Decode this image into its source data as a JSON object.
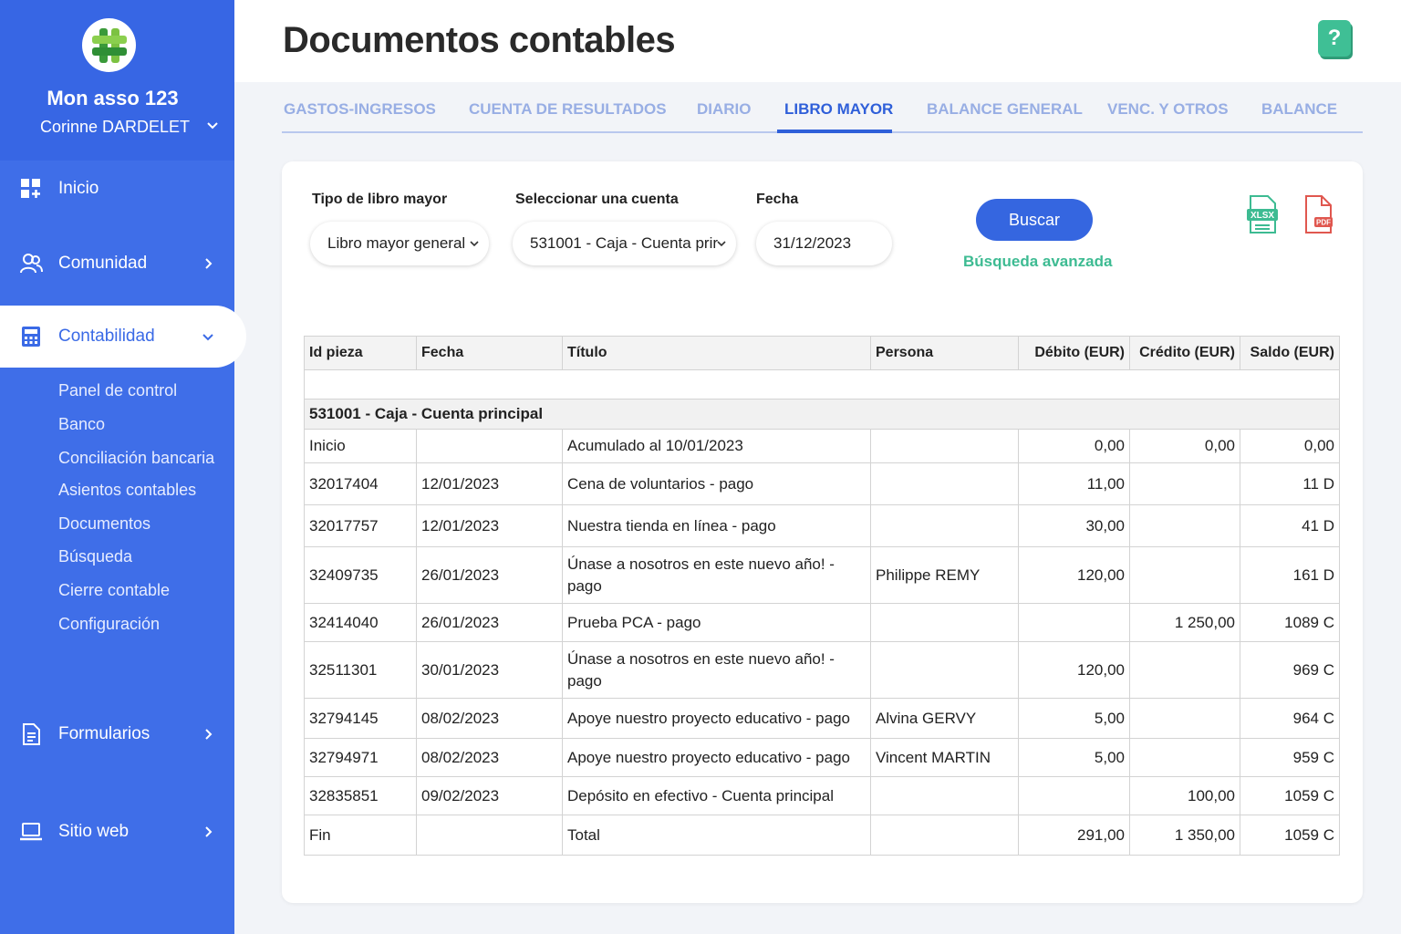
{
  "sidebar": {
    "org_name": "Mon asso 123",
    "user_name": "Corinne DARDELET",
    "nav": {
      "inicio": "Inicio",
      "comunidad": "Comunidad",
      "contabilidad": "Contabilidad",
      "formularios": "Formularios",
      "sitio_web": "Sitio web"
    },
    "sub_items": [
      "Panel de control",
      "Banco",
      "Conciliación bancaria",
      "Asientos contables",
      "Documentos",
      "Búsqueda",
      "Cierre contable",
      "Configuración"
    ]
  },
  "header": {
    "title": "Documentos contables",
    "help_label": "?"
  },
  "tabs": [
    "GASTOS-INGRESOS",
    "CUENTA DE RESULTADOS",
    "DIARIO",
    "LIBRO MAYOR",
    "BALANCE GENERAL",
    "VENC. Y OTROS",
    "BALANCE"
  ],
  "active_tab": "LIBRO MAYOR",
  "filters": {
    "tipo_label": "Tipo de libro mayor",
    "tipo_value": "Libro mayor general",
    "cuenta_label": "Seleccionar una cuenta",
    "cuenta_value": "531001 - Caja - Cuenta prir",
    "fecha_label": "Fecha",
    "fecha_value": "31/12/2023",
    "search_button": "Buscar",
    "advanced_link": "Búsqueda avanzada",
    "xlsx_label": "XLSX",
    "pdf_label": "PDF"
  },
  "table": {
    "headers": [
      "Id pieza",
      "Fecha",
      "Título",
      "Persona",
      "Débito (EUR)",
      "Crédito (EUR)",
      "Saldo (EUR)"
    ],
    "account_row": "531001 - Caja - Cuenta principal",
    "rows": [
      [
        "Inicio",
        "",
        "Acumulado al 10/01/2023",
        "",
        "0,00",
        "0,00",
        "0,00"
      ],
      [
        "32017404",
        "12/01/2023",
        "Cena de voluntarios - pago",
        "",
        "11,00",
        "",
        "11 D"
      ],
      [
        "32017757",
        "12/01/2023",
        "Nuestra tienda en línea - pago",
        "",
        "30,00",
        "",
        "41 D"
      ],
      [
        "32409735",
        "26/01/2023",
        "Únase a nosotros en este nuevo año! - pago",
        "Philippe REMY",
        "120,00",
        "",
        "161 D"
      ],
      [
        "32414040",
        "26/01/2023",
        "Prueba PCA - pago",
        "",
        "",
        "1 250,00",
        "1089 C"
      ],
      [
        "32511301",
        "30/01/2023",
        "Únase a nosotros en este nuevo año! - pago",
        "",
        "120,00",
        "",
        "969 C"
      ],
      [
        "32794145",
        "08/02/2023",
        "Apoye nuestro proyecto educativo - pago",
        "Alvina GERVY",
        "5,00",
        "",
        "964 C"
      ],
      [
        "32794971",
        "08/02/2023",
        "Apoye nuestro proyecto educativo - pago",
        "Vincent MARTIN",
        "5,00",
        "",
        "959 C"
      ],
      [
        "32835851",
        "09/02/2023",
        "Depósito en efectivo - Cuenta principal",
        "",
        "",
        "100,00",
        "1059 C"
      ],
      [
        "Fin",
        "",
        "Total",
        "",
        "291,00",
        "1 350,00",
        "1059 C"
      ]
    ]
  },
  "colors": {
    "sidebar": "#3f6ee8",
    "accent": "#2f5fd9",
    "green": "#3dbb92",
    "pdf_red": "#e0574f"
  }
}
